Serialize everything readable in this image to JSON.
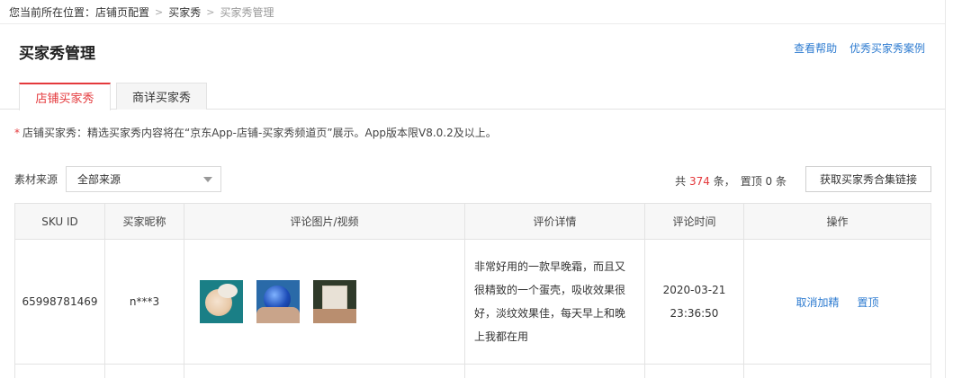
{
  "breadcrumb": {
    "prefix": "您当前所在位置：",
    "items": [
      "店铺页配置",
      "买家秀",
      "买家秀管理"
    ],
    "separator": ">"
  },
  "page": {
    "title": "买家秀管理",
    "help_links": [
      "查看帮助",
      "优秀买家秀案例"
    ]
  },
  "tabs": [
    {
      "label": "店铺买家秀",
      "active": true
    },
    {
      "label": "商详买家秀",
      "active": false
    }
  ],
  "notice": {
    "star": "*",
    "text": "店铺买家秀：精选买家秀内容将在“京东App-店铺-买家秀频道页”展示。App版本限V8.0.2及以上。"
  },
  "filter": {
    "label": "素材来源",
    "select_value": "全部来源"
  },
  "summary": {
    "total_prefix": "共 ",
    "total": "374",
    "total_suffix": " 条，",
    "pinned_text": "置顶 0 条"
  },
  "actions": {
    "get_link_button": "获取买家秀合集链接"
  },
  "table": {
    "headers": [
      "SKU ID",
      "买家昵称",
      "评论图片/视频",
      "评价详情",
      "评论时间",
      "操作"
    ],
    "rows": [
      {
        "sku": "65998781469",
        "buyer": "n***3",
        "images": [
          "cream-jar-image",
          "blue-ball-product-image",
          "box-product-image"
        ],
        "detail": "非常好用的一款早晚霜，而且又很精致的一个蛋壳，吸收效果很好，淡纹效果佳，每天早上和晚上我都在用",
        "date": "2020-03-21",
        "time": "23:36:50",
        "ops": [
          "取消加精",
          "置顶"
        ]
      }
    ]
  },
  "colors": {
    "accent_red": "#e4393c",
    "link_blue": "#2d7bd0"
  }
}
